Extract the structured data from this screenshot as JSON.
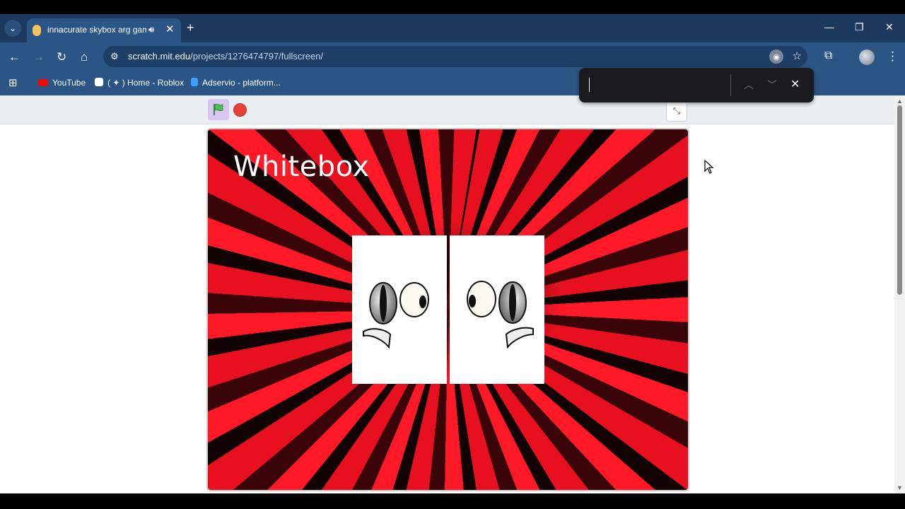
{
  "browser": {
    "tab": {
      "title": "innacurate skybox arg game",
      "audio_icon": "speaker-icon"
    },
    "address": {
      "host": "scratch.mit.edu",
      "path": "/projects/1276474797/fullscreen/"
    },
    "bookmarks": [
      {
        "label": "YouTube",
        "icon": "youtube-icon",
        "color": "#ff0000"
      },
      {
        "label": "( ✦ ) Home - Roblox",
        "icon": "roblox-icon",
        "color": "#ffffff"
      },
      {
        "label": "Adservio - platform...",
        "icon": "adservio-icon",
        "color": "#3aa0ff"
      }
    ],
    "find_bar": {
      "value": ""
    }
  },
  "stage": {
    "title": "Whitebox",
    "background_colors": [
      "#e8101e",
      "#120404"
    ]
  }
}
